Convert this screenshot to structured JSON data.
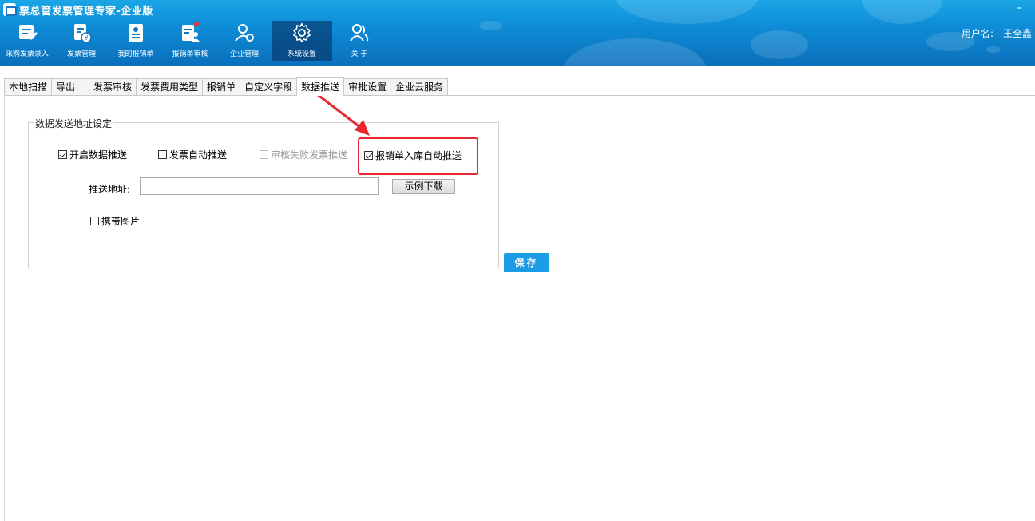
{
  "app": {
    "title": "票总管发票管理专家-企业版",
    "minimize_glyph": "–"
  },
  "toolbar": [
    {
      "label": "采购发票录入",
      "icon": "purchase-invoice-icon"
    },
    {
      "label": "发票管理",
      "icon": "invoice-manage-icon"
    },
    {
      "label": "我的报销单",
      "icon": "my-expense-icon"
    },
    {
      "label": "报销单审核",
      "icon": "expense-review-icon"
    },
    {
      "label": "企业管理",
      "icon": "enterprise-icon"
    },
    {
      "label": "系统设置",
      "icon": "gear-icon",
      "active": true
    },
    {
      "label": "关 于",
      "icon": "about-icon"
    }
  ],
  "user": {
    "label": "用户名:",
    "name": "王全鑫"
  },
  "tabs": [
    {
      "label": "本地扫描"
    },
    {
      "label": "导出"
    },
    {
      "label": "发票审核"
    },
    {
      "label": "发票费用类型"
    },
    {
      "label": "报销单"
    },
    {
      "label": "自定义字段"
    },
    {
      "label": "数据推送",
      "active": true
    },
    {
      "label": "审批设置"
    },
    {
      "label": "企业云服务"
    }
  ],
  "settings": {
    "group_title": "数据发送地址设定",
    "enable_push": {
      "label": "开启数据推送",
      "checked": true
    },
    "invoice_auto_push": {
      "label": "发票自动推送",
      "checked": false
    },
    "review_failed_push": {
      "label": "审核失败发票推送",
      "checked": false,
      "disabled": true
    },
    "expense_auto_push": {
      "label": "报销单入库自动推送",
      "checked": true
    },
    "address_label": "推送地址:",
    "address_value": "",
    "example_button": "示例下载",
    "carry_images": {
      "label": "携带图片",
      "checked": false
    },
    "save_button": "保存"
  },
  "colors": {
    "header_top": "#1aa6e6",
    "header_bottom": "#0a6fbc",
    "save_button": "#1c9be6",
    "annotation": "#e8262e"
  }
}
